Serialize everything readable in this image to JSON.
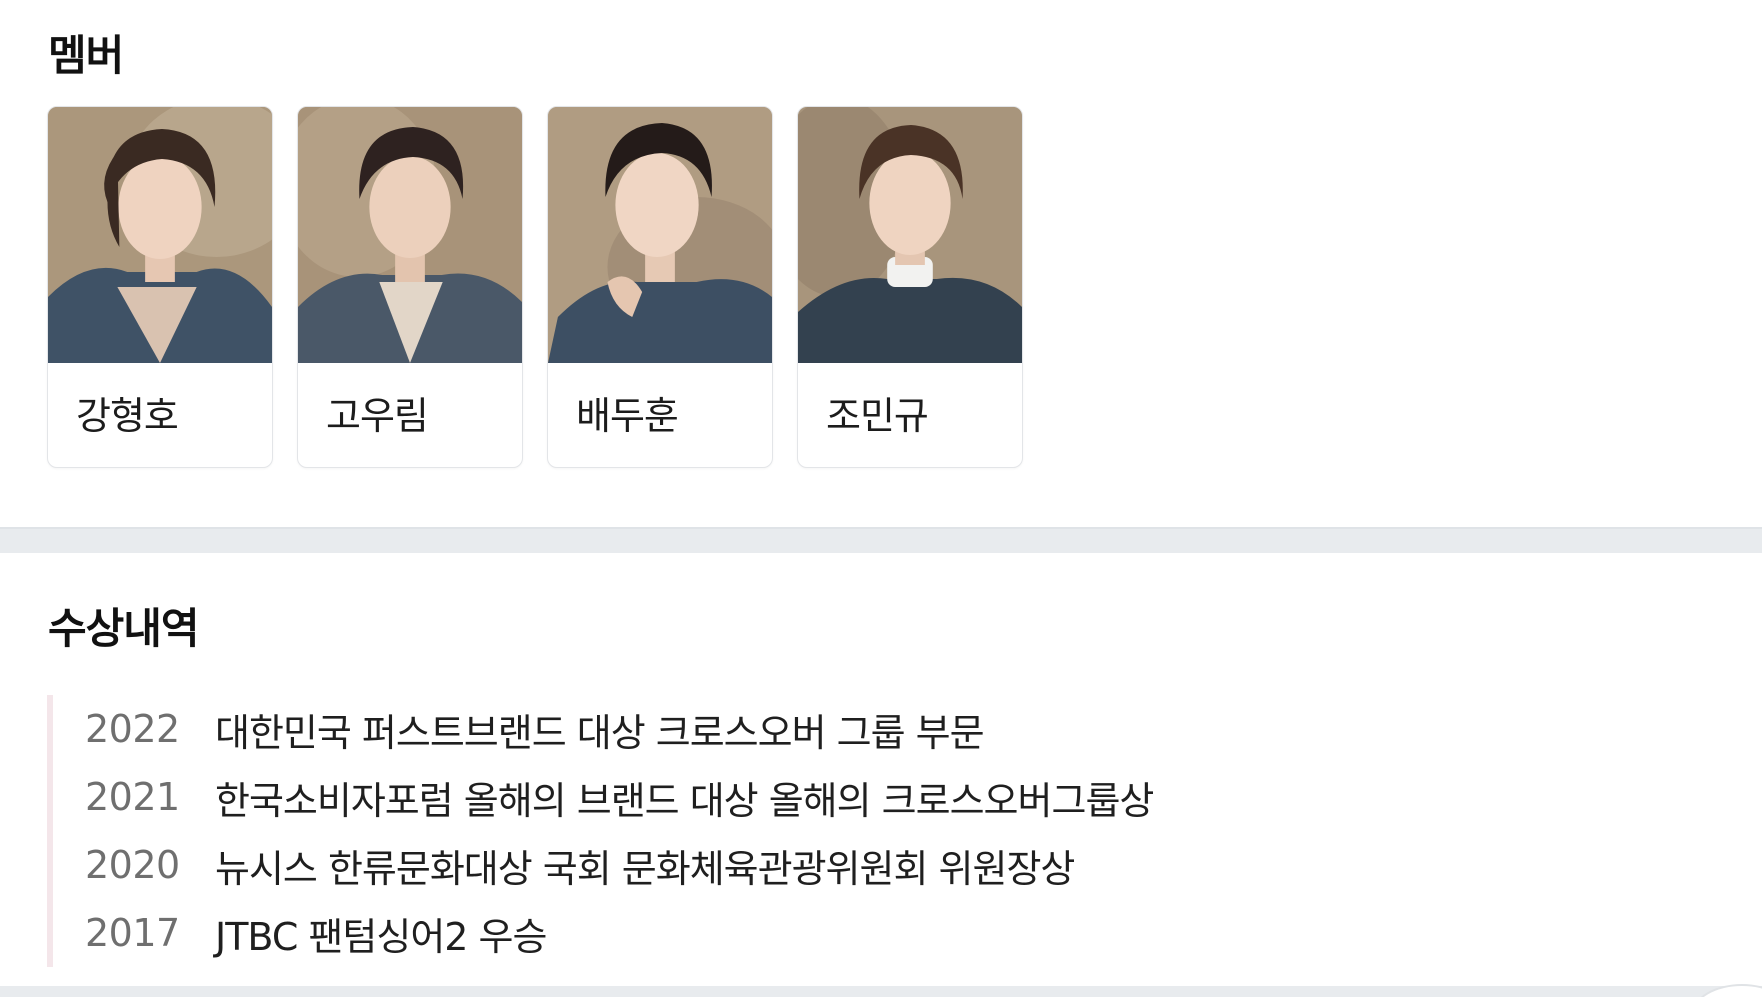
{
  "members": {
    "title": "멤버",
    "items": [
      {
        "name": "강형호",
        "photo_icon": "member-portrait"
      },
      {
        "name": "고우림",
        "photo_icon": "member-portrait"
      },
      {
        "name": "배두훈",
        "photo_icon": "member-portrait"
      },
      {
        "name": "조민규",
        "photo_icon": "member-portrait"
      }
    ]
  },
  "awards": {
    "title": "수상내역",
    "items": [
      {
        "year": "2022",
        "title": "대한민국 퍼스트브랜드 대상 크로스오버 그룹 부문"
      },
      {
        "year": "2021",
        "title": "한국소비자포럼 올해의 브랜드 대상 올해의 크로스오버그룹상"
      },
      {
        "year": "2020",
        "title": "뉴시스 한류문화대상 국회 문화체육관광위원회 위원장상"
      },
      {
        "year": "2017",
        "title": "JTBC 팬텀싱어2 우승"
      }
    ]
  },
  "colors": {
    "divider": "#e8ebee",
    "timeline_line": "#f4e6ea",
    "year_text": "#6f6f6f",
    "photo_backdrop": "#a18d73",
    "jacket_denim": "#3f5266"
  }
}
